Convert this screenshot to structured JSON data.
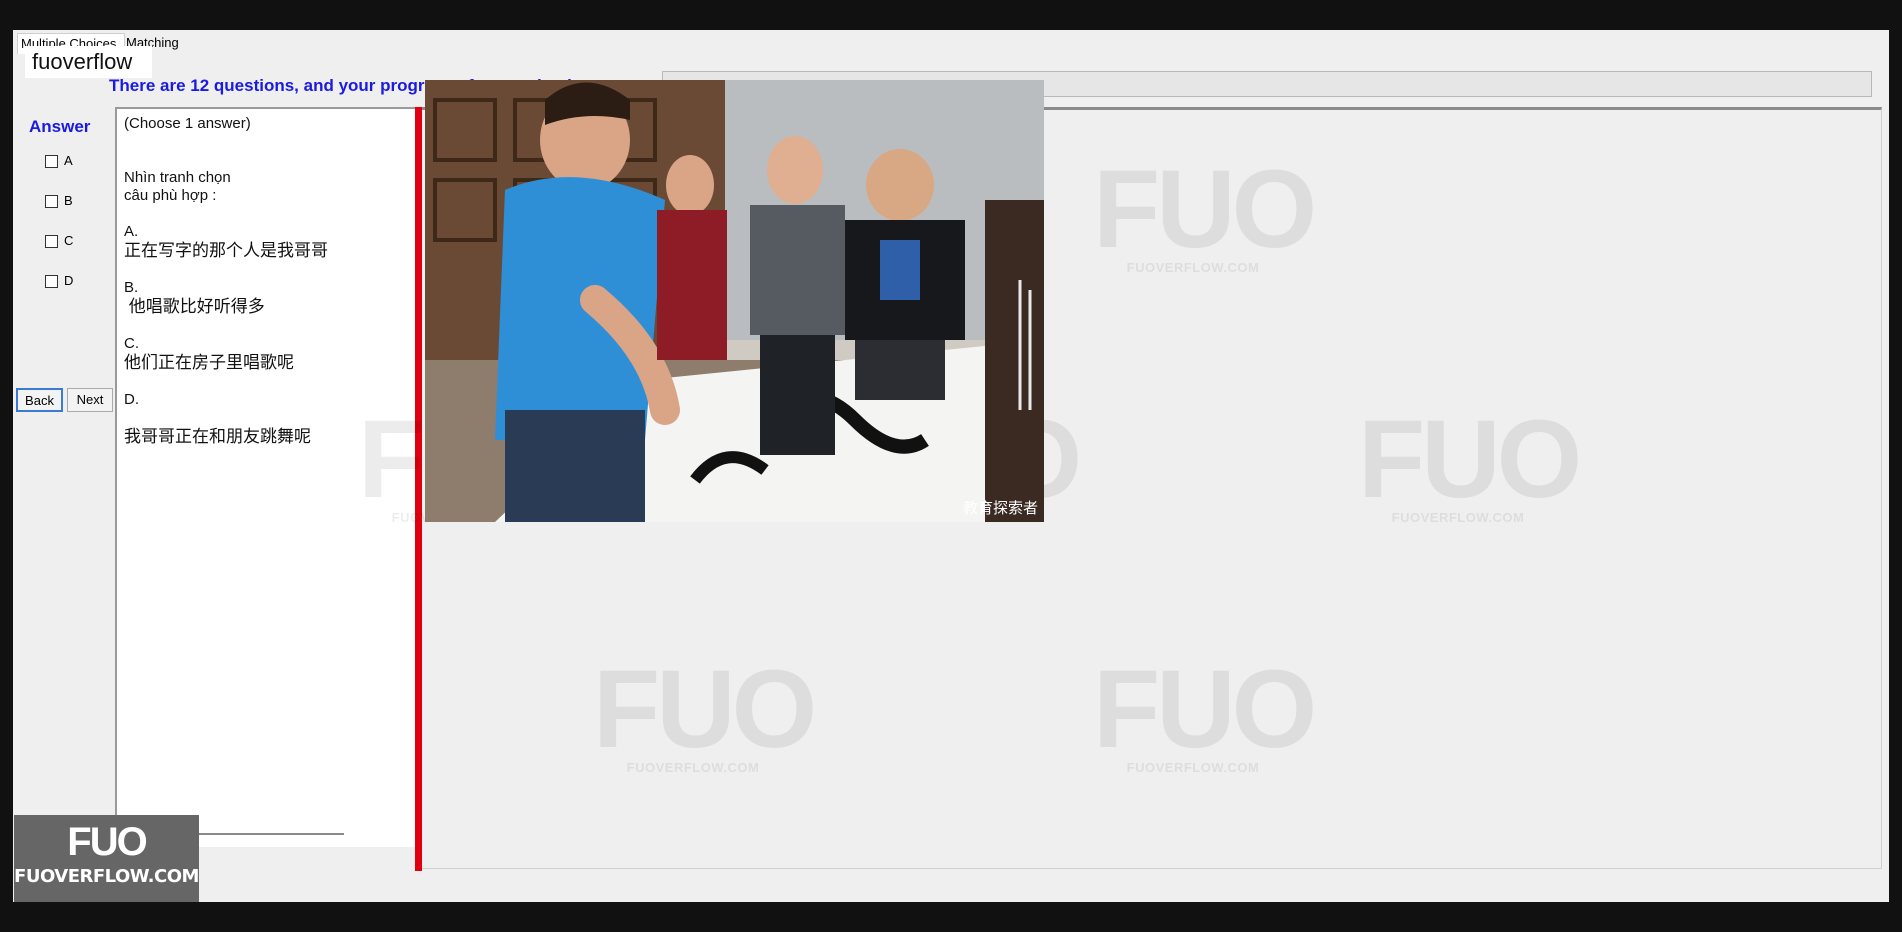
{
  "tabs": [
    {
      "label": "Multiple Choices"
    },
    {
      "label": "Matching"
    }
  ],
  "brand": "fuoverflow",
  "progress": {
    "label": "There are 12 questions, and your progress of answering is",
    "value_percent": 0
  },
  "answer": {
    "title": "Answer",
    "options": [
      "A",
      "B",
      "C",
      "D"
    ]
  },
  "nav": {
    "back": "Back",
    "next": "Next"
  },
  "question": {
    "hint": "(Choose 1 answer)",
    "prompt_1": "Nhìn tranh chọn",
    "prompt_2": "câu phù hợp :",
    "a_label": "A.",
    "a_text": "正在写字的那个人是我哥哥",
    "b_label": "B.",
    "b_text": " 他唱歌比好听得多",
    "c_label": "C.",
    "c_text": "他们正在房子里唱歌呢",
    "d_label": "D.",
    "d_text": "我哥哥正在和朋友跳舞呢"
  },
  "photo_caption": "教育探索者",
  "watermark": {
    "big": "FUO",
    "small": "FUOVERFLOW.COM"
  },
  "logo": {
    "big": "FUO",
    "small": "FUOVERFLOW.COM"
  }
}
